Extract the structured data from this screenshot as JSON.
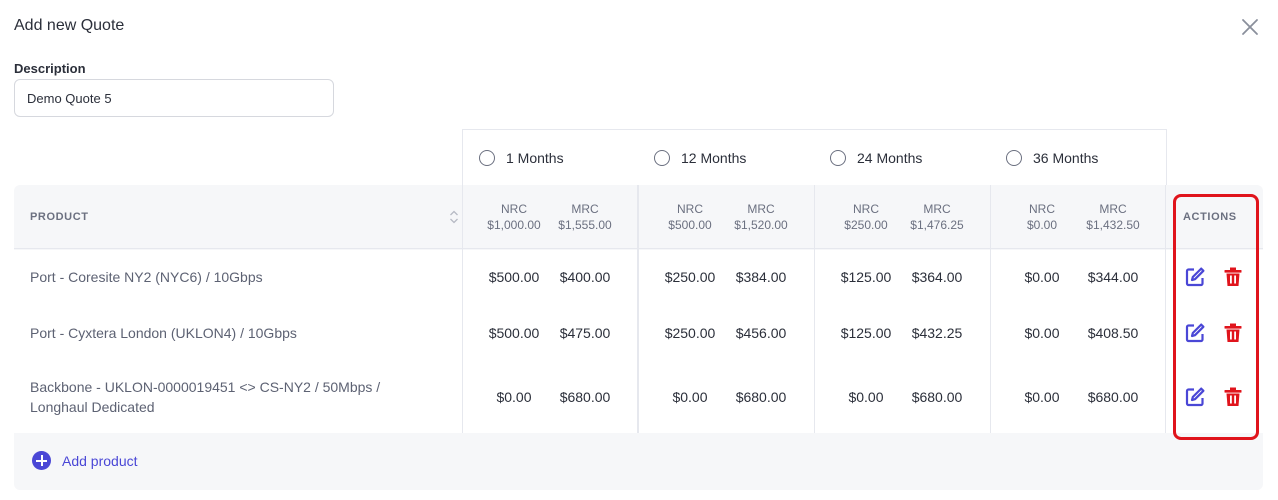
{
  "modal": {
    "title": "Add new Quote"
  },
  "description": {
    "label": "Description",
    "value": "Demo Quote 5"
  },
  "terms": [
    {
      "label": "1 Months",
      "nrc_label": "NRC",
      "nrc_total": "$1,000.00",
      "mrc_label": "MRC",
      "mrc_total": "$1,555.00"
    },
    {
      "label": "12 Months",
      "nrc_label": "NRC",
      "nrc_total": "$500.00",
      "mrc_label": "MRC",
      "mrc_total": "$1,520.00"
    },
    {
      "label": "24 Months",
      "nrc_label": "NRC",
      "nrc_total": "$250.00",
      "mrc_label": "MRC",
      "mrc_total": "$1,476.25"
    },
    {
      "label": "36 Months",
      "nrc_label": "NRC",
      "nrc_total": "$0.00",
      "mrc_label": "MRC",
      "mrc_total": "$1,432.50"
    }
  ],
  "table": {
    "product_header": "PRODUCT",
    "actions_header": "ACTIONS",
    "rows": [
      {
        "product": "Port - Coresite NY2 (NYC6) / 10Gbps",
        "values": [
          [
            "$500.00",
            "$400.00"
          ],
          [
            "$250.00",
            "$384.00"
          ],
          [
            "$125.00",
            "$364.00"
          ],
          [
            "$0.00",
            "$344.00"
          ]
        ]
      },
      {
        "product": "Port - Cyxtera London (UKLON4) / 10Gbps",
        "values": [
          [
            "$500.00",
            "$475.00"
          ],
          [
            "$250.00",
            "$456.00"
          ],
          [
            "$125.00",
            "$432.25"
          ],
          [
            "$0.00",
            "$408.50"
          ]
        ]
      },
      {
        "product": "Backbone - UKLON-0000019451 <> CS-NY2 / 50Mbps / Longhaul Dedicated",
        "values": [
          [
            "$0.00",
            "$680.00"
          ],
          [
            "$0.00",
            "$680.00"
          ],
          [
            "$0.00",
            "$680.00"
          ],
          [
            "$0.00",
            "$680.00"
          ]
        ]
      }
    ]
  },
  "add_product": {
    "label": "Add product"
  },
  "colors": {
    "accent": "#4a47d6",
    "danger": "#e0141c",
    "highlight": "#e0141c"
  },
  "icons": {
    "close": "close-icon",
    "sort": "sort-icon",
    "edit": "edit-icon",
    "delete": "trash-icon",
    "add": "plus-circle-icon"
  }
}
